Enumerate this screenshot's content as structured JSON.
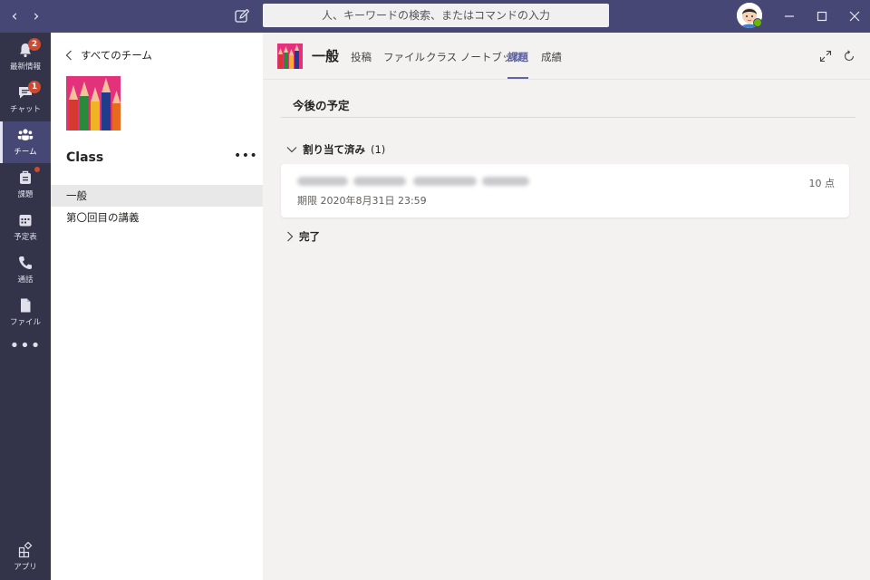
{
  "titlebar": {
    "back_glyph": "‹",
    "forward_glyph": "›",
    "search_placeholder": "人、キーワードの検索、またはコマンドの入力"
  },
  "rail": {
    "items": [
      {
        "label": "最新情報",
        "icon": "bell-icon",
        "badge": "2"
      },
      {
        "label": "チャット",
        "icon": "chat-icon",
        "badge": "1"
      },
      {
        "label": "チーム",
        "icon": "teams-icon",
        "badge": ""
      },
      {
        "label": "課題",
        "icon": "assignments-icon",
        "badge": ""
      },
      {
        "label": "予定表",
        "icon": "calendar-icon",
        "badge": ""
      },
      {
        "label": "通話",
        "icon": "phone-icon",
        "badge": ""
      },
      {
        "label": "ファイル",
        "icon": "file-icon",
        "badge": ""
      },
      {
        "label": "アプリ",
        "icon": "apps-icon",
        "badge": ""
      }
    ],
    "more": "•••"
  },
  "panel": {
    "back_label": "すべてのチーム",
    "team_name": "Class",
    "more": "•••",
    "channels": [
      {
        "label": "一般",
        "active": true
      },
      {
        "label": "第〇回目の講義",
        "active": false
      }
    ]
  },
  "main": {
    "channel_name": "一般",
    "tabs": [
      {
        "label": "投稿"
      },
      {
        "label": "ファイル"
      },
      {
        "label": "クラス ノートブック"
      },
      {
        "label": "課題",
        "active": true
      },
      {
        "label": "成績"
      }
    ],
    "section_title": "今後の予定",
    "assigned": {
      "label": "割り当て済み",
      "count": "(1)"
    },
    "card": {
      "due": "期限 2020年8月31日 23:59",
      "points": "10 点"
    },
    "completed": {
      "label": "完了"
    }
  },
  "colors": {
    "titlebar": "#464775",
    "rail": "#33344a",
    "accent": "#6264a7",
    "badge": "#cc4a31",
    "presence": "#6bb700",
    "team_image": "#e3317b"
  }
}
